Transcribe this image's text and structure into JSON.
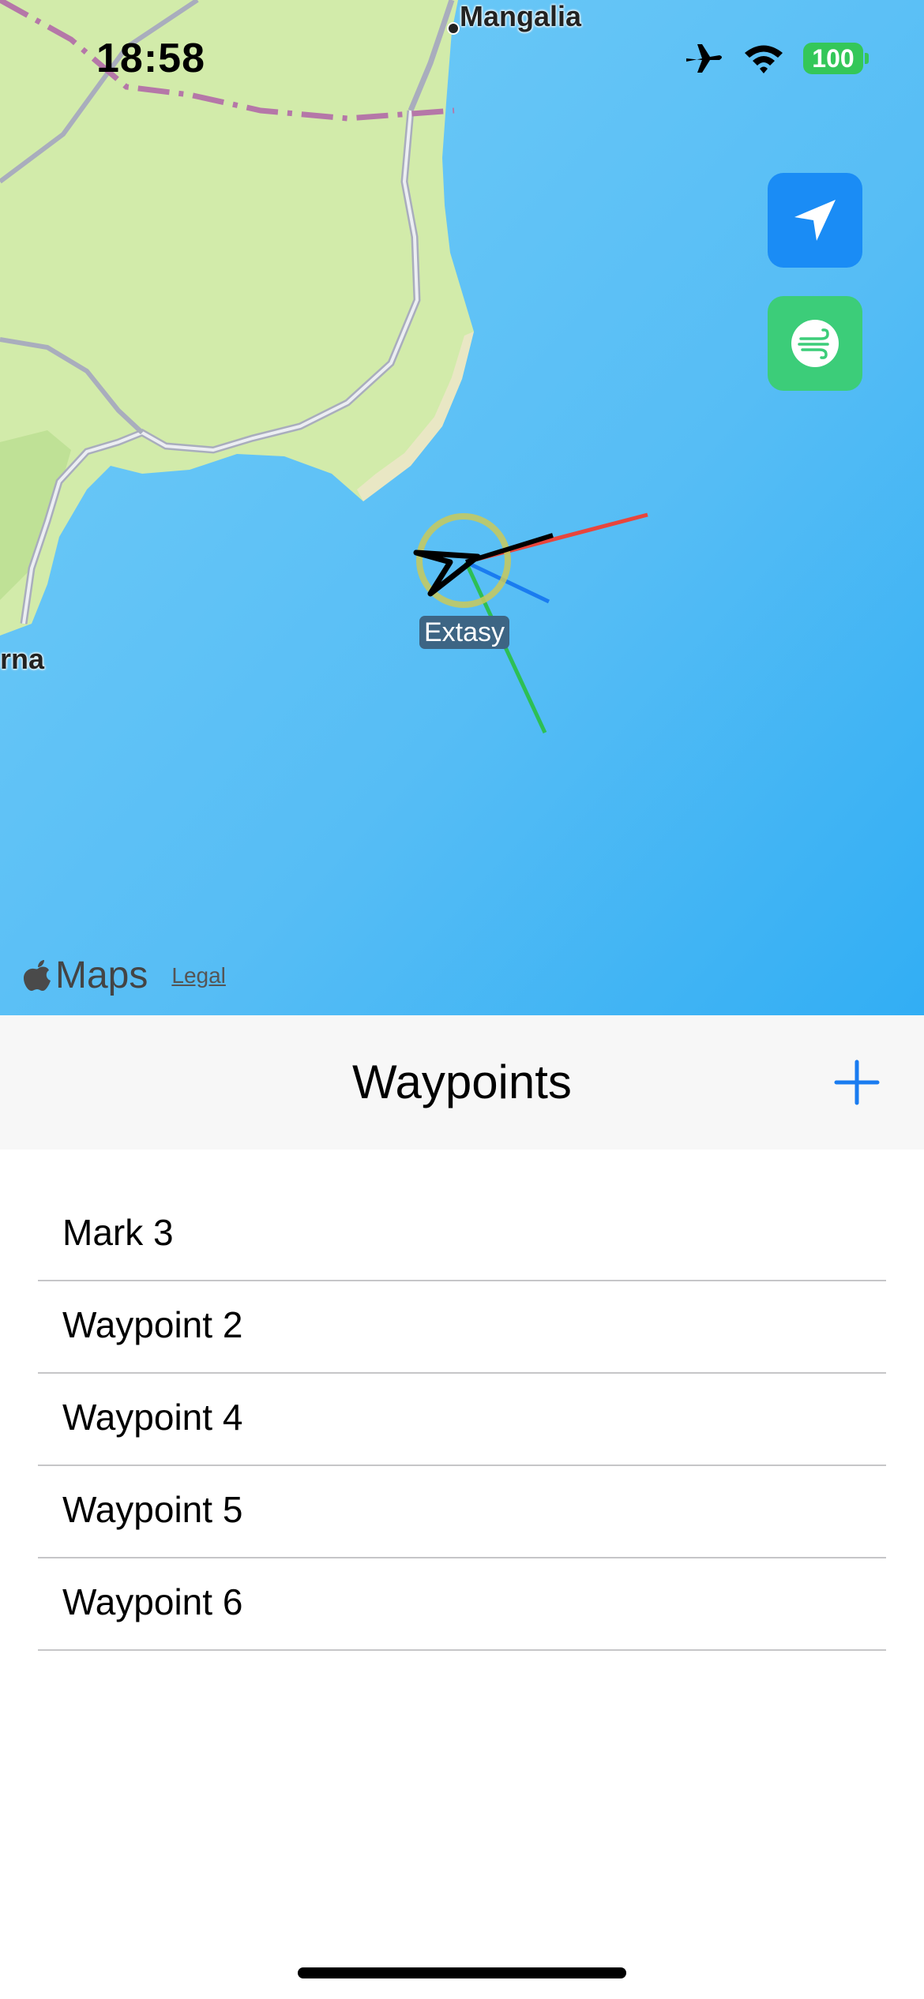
{
  "status_bar": {
    "time": "18:58",
    "battery": "100",
    "airplane_icon": "airplane-icon",
    "wifi_icon": "wifi-icon"
  },
  "map": {
    "labels": {
      "mangalia": "Mangalia",
      "varna": "rna"
    },
    "vessel_name": "Extasy",
    "buttons": {
      "locate_icon": "location-arrow-icon",
      "wind_icon": "wind-icon"
    },
    "attribution": {
      "brand": "Maps",
      "legal": "Legal"
    },
    "colors": {
      "sea": "#5bbdf7",
      "land": "#d4ecac",
      "heading": "#000000",
      "wind_line": "#e8453c",
      "current_line": "#1a7cf0",
      "course_line": "#2dbf55",
      "vessel_ring": "#c9c95a"
    }
  },
  "waypoints_panel": {
    "title": "Waypoints",
    "add_icon": "plus-icon",
    "accent_color": "#1a7cf0",
    "items": [
      {
        "label": "Mark 3"
      },
      {
        "label": "Waypoint 2"
      },
      {
        "label": "Waypoint 4"
      },
      {
        "label": "Waypoint 5"
      },
      {
        "label": "Waypoint 6"
      }
    ]
  }
}
